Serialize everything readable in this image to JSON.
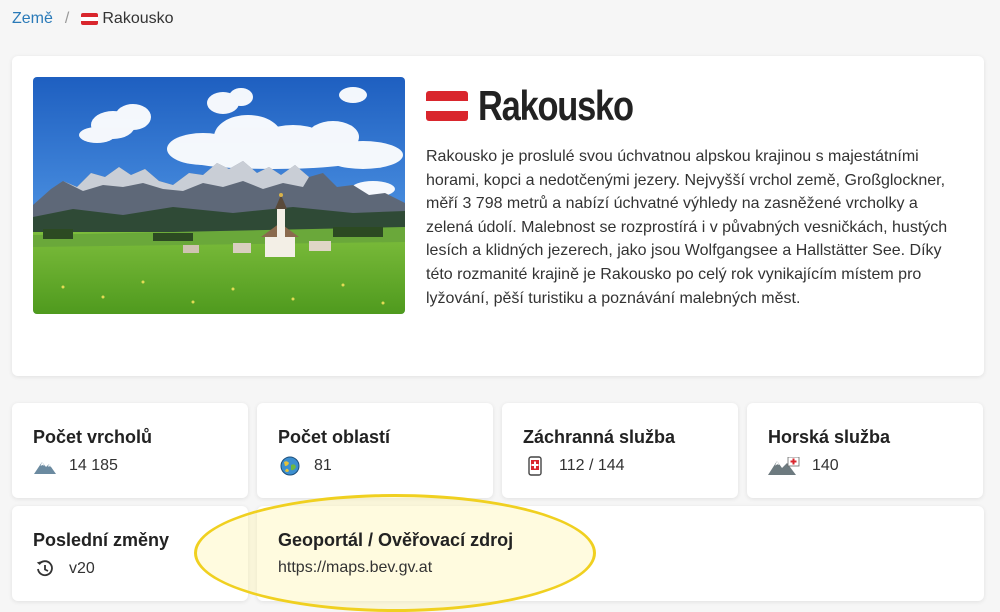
{
  "breadcrumb": {
    "root": "Země",
    "separator": "/",
    "current": "Rakousko"
  },
  "country": {
    "name": "Rakousko",
    "flag_colors": [
      "#d9262d",
      "#ffffff",
      "#d9262d"
    ],
    "description": "Rakousko je proslulé svou úchvatnou alpskou krajinou s majestátními horami, kopci a nedotčenými jezery. Nejvyšší vrchol země, Großglockner, měří 3 798 metrů a nabízí úchvatné výhledy na zasněžené vrcholky a zelená údolí. Malebnost se rozprostírá i v půvabných vesničkách, hustých lesích a klidných jezerech, jako jsou Wolfgangsee a Hallstätter See. Díky této rozmanité krajině je Rakousko po celý rok vynikajícím místem pro lyžování, pěší turistiku a poznávání malebných měst."
  },
  "stats": {
    "peaks": {
      "label": "Počet vrcholů",
      "value": "14 185",
      "icon": "mountains-icon"
    },
    "regions": {
      "label": "Počet oblastí",
      "value": "81",
      "icon": "regions-globe-icon"
    },
    "rescue": {
      "label": "Záchranná služba",
      "value": "112 / 144",
      "icon": "mobile-phone-icon"
    },
    "mountain_service": {
      "label": "Horská služba",
      "value": "140",
      "icon": "mountain-rescue-icon"
    },
    "changes": {
      "label": "Poslední změny",
      "value": "v20",
      "icon": "history-icon"
    },
    "geoportal": {
      "label": "Geoportál / Ověřovací zdroj",
      "value": "https://maps.bev.gv.at"
    }
  },
  "colors": {
    "link": "#2a7ab8",
    "highlight_border": "#f0d020",
    "austria_red": "#d9262d"
  }
}
